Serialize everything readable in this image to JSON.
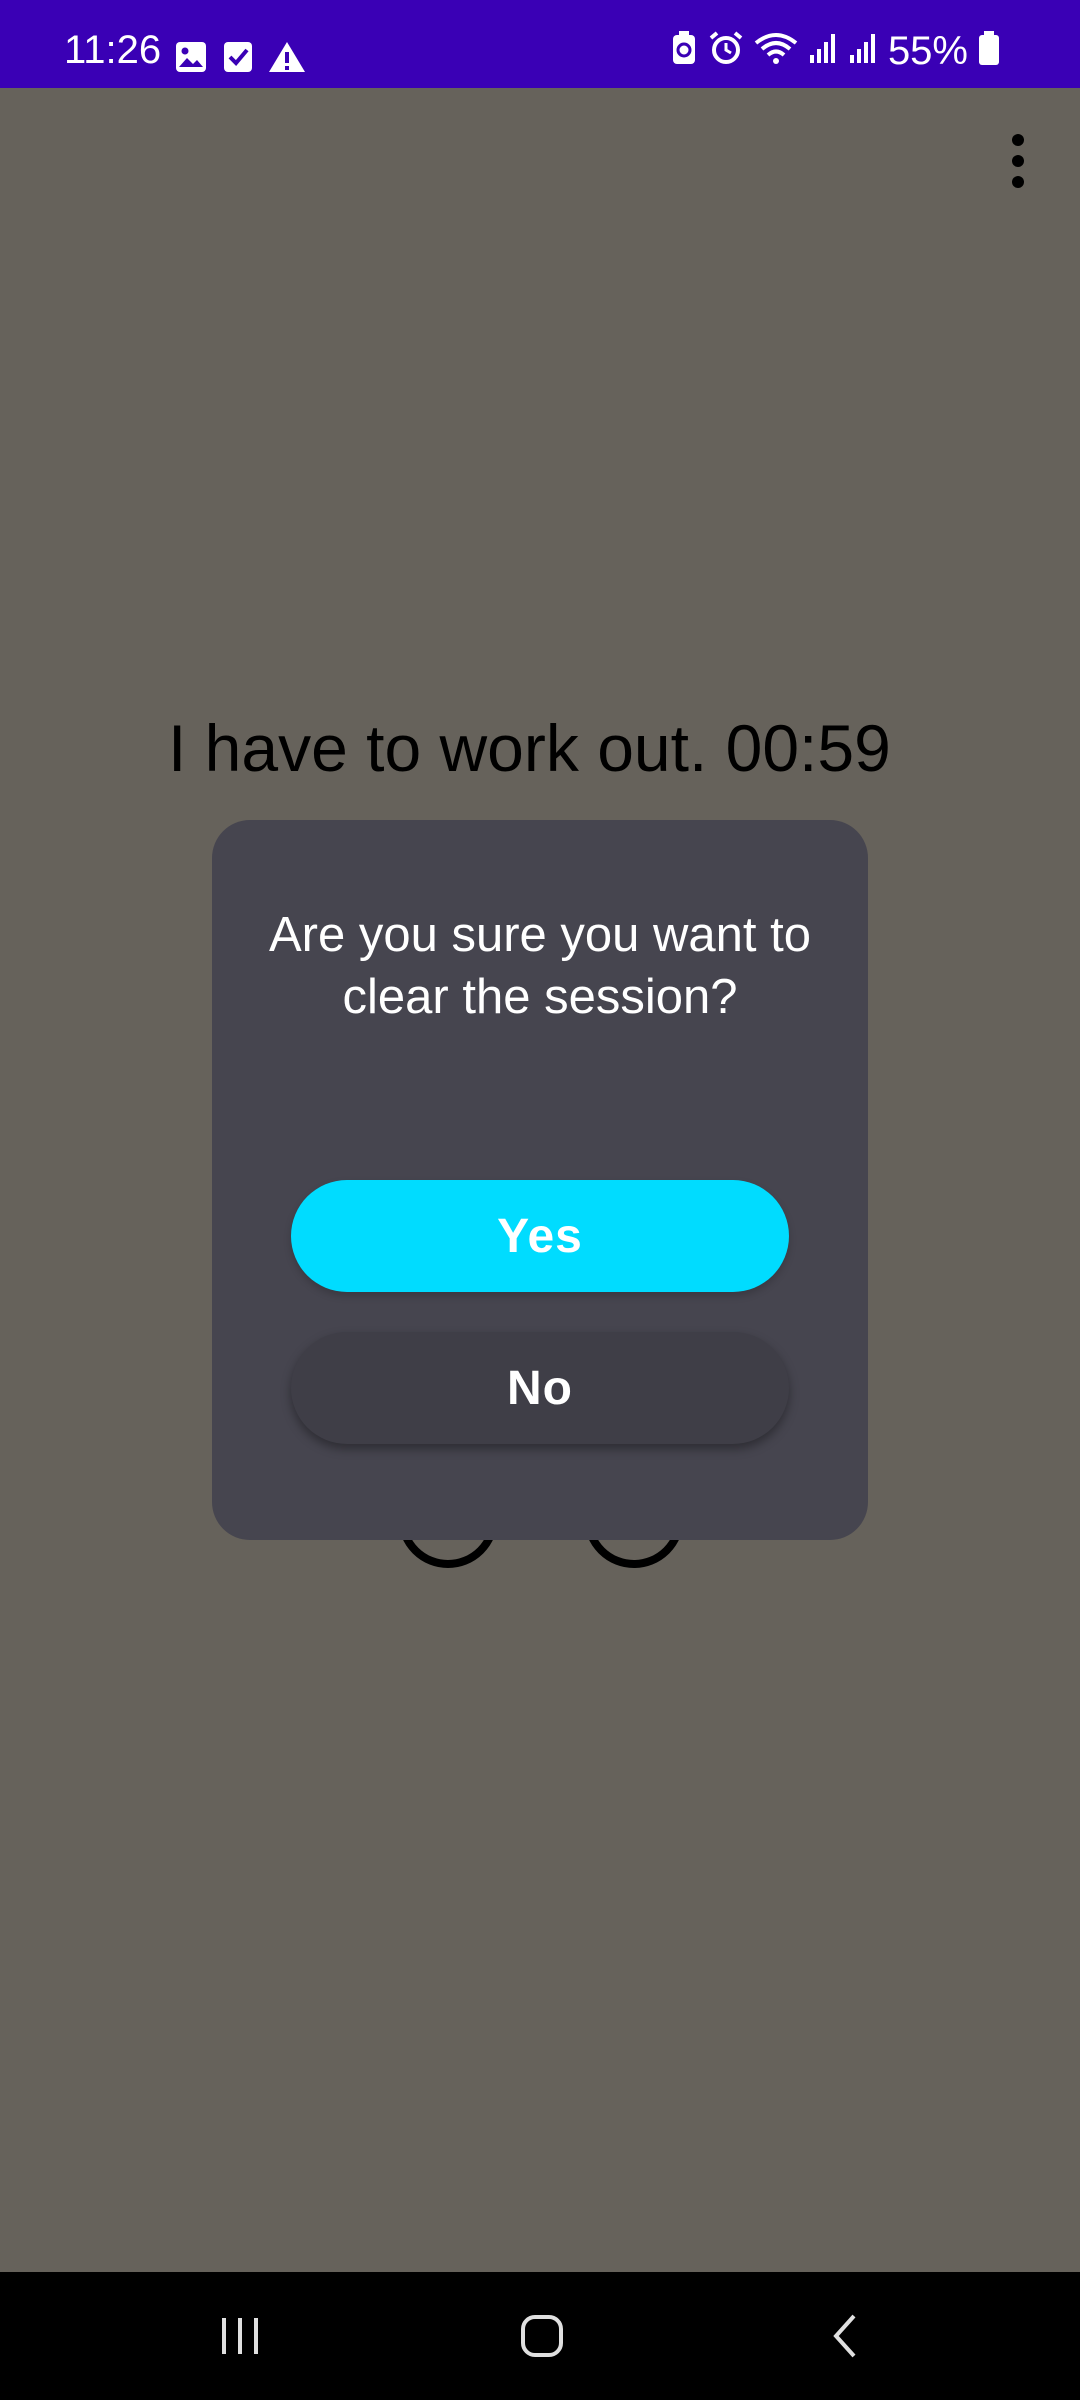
{
  "status_bar": {
    "time": "11:26",
    "battery_text": "55%",
    "left_icons": [
      "image-icon",
      "checkbox-icon",
      "warning-icon"
    ],
    "right_icons": [
      "battery-saver-icon",
      "alarm-icon",
      "wifi-icon",
      "signal-icon",
      "signal-icon",
      "battery-icon"
    ],
    "background_color": "#3a00b5"
  },
  "app": {
    "background_color": "#66625b",
    "background_text": "I have to work out. 00:59",
    "menu_icon": "more-vert-icon"
  },
  "dialog": {
    "title": "Are you sure you want to clear the session?",
    "yes_label": "Yes",
    "no_label": "No",
    "background_color": "#46454f",
    "yes_color": "#00dcff"
  },
  "nav_bar": {
    "icons": [
      "recents-icon",
      "home-icon",
      "back-icon"
    ]
  }
}
